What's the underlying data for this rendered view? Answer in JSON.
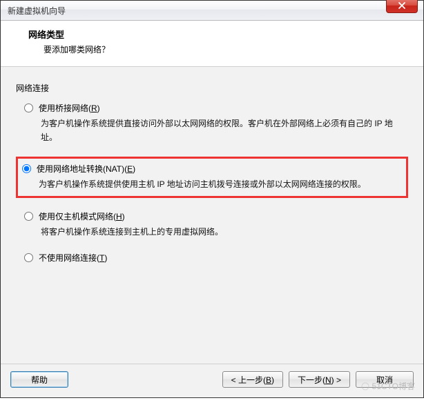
{
  "window": {
    "title": "新建虚拟机向导"
  },
  "header": {
    "title": "网络类型",
    "subtitle": "要添加哪类网络？"
  },
  "section_label": "网络连接",
  "options": [
    {
      "id": "bridge",
      "label_pre": "使用桥接网络(",
      "mnemonic": "R",
      "label_post": ")",
      "desc": "为客户机操作系统提供直接访问外部以太网网络的权限。客户机在外部网络上必须有自己的 IP 地址。",
      "checked": false,
      "highlight": false
    },
    {
      "id": "nat",
      "label_pre": "使用网络地址转换(NAT)(",
      "mnemonic": "E",
      "label_post": ")",
      "desc": "为客户机操作系统提供使用主机 IP 地址访问主机拨号连接或外部以太网网络连接的权限。",
      "checked": true,
      "highlight": true
    },
    {
      "id": "hostonly",
      "label_pre": "使用仅主机模式网络(",
      "mnemonic": "H",
      "label_post": ")",
      "desc": "将客户机操作系统连接到主机上的专用虚拟网络。",
      "checked": false,
      "highlight": false
    },
    {
      "id": "none",
      "label_pre": "不使用网络连接(",
      "mnemonic": "T",
      "label_post": ")",
      "desc": "",
      "checked": false,
      "highlight": false
    }
  ],
  "buttons": {
    "help": "帮助",
    "back_pre": "< 上一步(",
    "back_mn": "B",
    "back_post": ")",
    "next_pre": "下一步(",
    "next_mn": "N",
    "next_post": ") >",
    "cancel": "取消"
  },
  "watermark": "51CTO博客"
}
